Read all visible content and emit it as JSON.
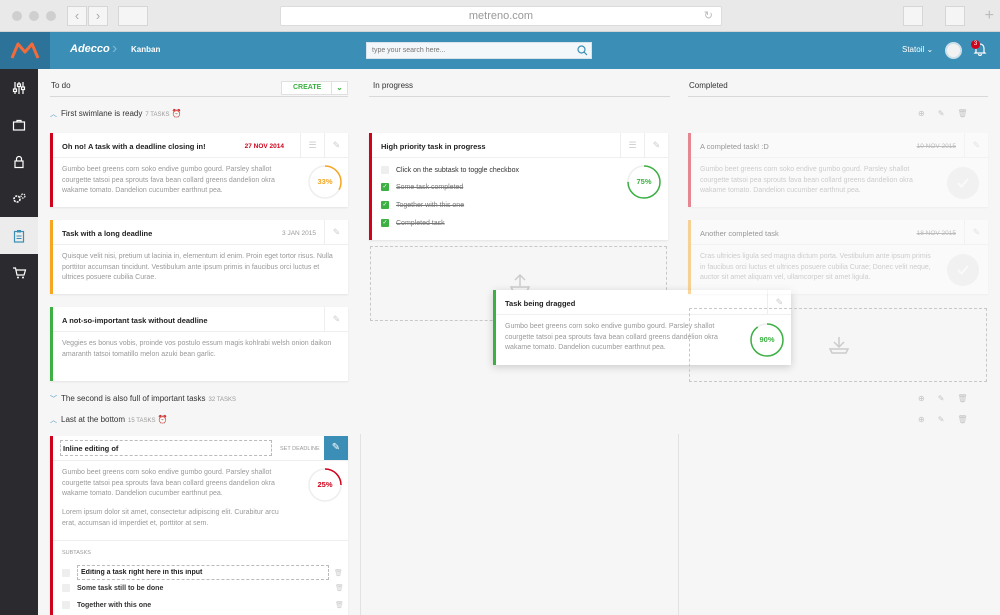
{
  "browser": {
    "url": "metreno.com"
  },
  "header": {
    "brand": "Adecco",
    "breadcrumb": "Kanban",
    "search_placeholder": "type your search here...",
    "account": "Statoil",
    "notifications": "3"
  },
  "sidebar": {
    "items": [
      "sliders-icon",
      "briefcase-icon",
      "lock-icon",
      "gears-icon",
      "clipboard-icon",
      "cart-icon"
    ],
    "active_index": 4
  },
  "columns": {
    "todo": "To do",
    "in_progress": "In progress",
    "completed": "Completed",
    "create": "CREATE"
  },
  "lanes": [
    {
      "title": "First swimlane is ready",
      "count": "7 TASKS"
    },
    {
      "title": "The second is also full of important tasks",
      "count": "32 TASKS"
    },
    {
      "title": "Last at the bottom",
      "count": "15 TASKS"
    }
  ],
  "cards": {
    "c1": {
      "title": "Oh no! A task with a deadline closing in!",
      "date": "27 NOV 2014",
      "body": "Gumbo beet greens corn soko endive gumbo gourd. Parsley shallot courgette tatsoi pea sprouts fava bean collard greens dandelion okra wakame tomato. Dandelion cucumber earthnut pea.",
      "progress": "33%",
      "progress_value": 0.33
    },
    "c2": {
      "title": "Task with a long deadline",
      "date": "3 JAN 2015",
      "body": "Quisque velit nisi, pretium ut lacinia in, elementum id enim. Proin eget tortor risus. Nulla porttitor accumsan tincidunt. Vestibulum ante ipsum primis in faucibus orci luctus et ultrices posuere cubilia Curae."
    },
    "c3": {
      "title": "A not-so-important task without deadline",
      "body": "Veggies es bonus vobis, proinde vos postulo essum magis kohlrabi welsh onion daikon amaranth tatsoi tomatillo melon azuki bean garlic."
    },
    "c4": {
      "title": "High priority task in progress",
      "subtasks": [
        "Click on the subtask to toggle checkbox",
        "Some task completed",
        "Together with this one",
        "Completed task"
      ],
      "progress": "75%",
      "progress_value": 0.75
    },
    "c5": {
      "title": "Task being dragged",
      "body": "Gumbo beet greens corn soko endive gumbo gourd. Parsley shallot courgette tatsoi pea sprouts fava bean collard greens dandelion okra wakame tomato. Dandelion cucumber earthnut pea.",
      "progress": "90%",
      "progress_value": 0.9
    },
    "c6": {
      "title": "A completed task! :D",
      "date": "10 NOV 2015",
      "body": "Gumbo beet greens corn soko endive gumbo gourd. Parsley shallot courgette tatsoi pea sprouts fava bean collard greens dandelion okra wakame tomato. Dandelion cucumber earthnut pea."
    },
    "c7": {
      "title": "Another completed task",
      "date": "18 NOV 2015",
      "body": "Cras ultricies ligula sed magna dictum porta. Vestibulum ante ipsum primis in faucibus orci luctus et ultrices posuere cubilia Curae; Donec velit neque, auctor sit amet aliquam vel, ullamcorper sit amet ligula."
    },
    "c8": {
      "title_value": "Inline editing of",
      "set_deadline": "SET DEADLINE",
      "body1": "Gumbo beet greens corn soko endive gumbo gourd. Parsley shallot courgette tatsoi pea sprouts fava bean collard greens dandelion okra wakame tomato. Dandelion cucumber earthnut pea.",
      "body2": "Lorem ipsum dolor sit amet, consectetur adipiscing elit. Curabitur arcu erat, accumsan id imperdiet et, porttitor at sem.",
      "progress": "25%",
      "progress_value": 0.25,
      "subtasks_label": "SUBTASKS",
      "subtasks": [
        "Editing a task right here in this input",
        "Some task still to be done",
        "Together with this one"
      ]
    }
  },
  "colors": {
    "primary": "#3b8eb5",
    "danger": "#d0021b",
    "warning": "#f5a623",
    "success": "#3cb043",
    "sidebar": "#2b2b2f"
  }
}
